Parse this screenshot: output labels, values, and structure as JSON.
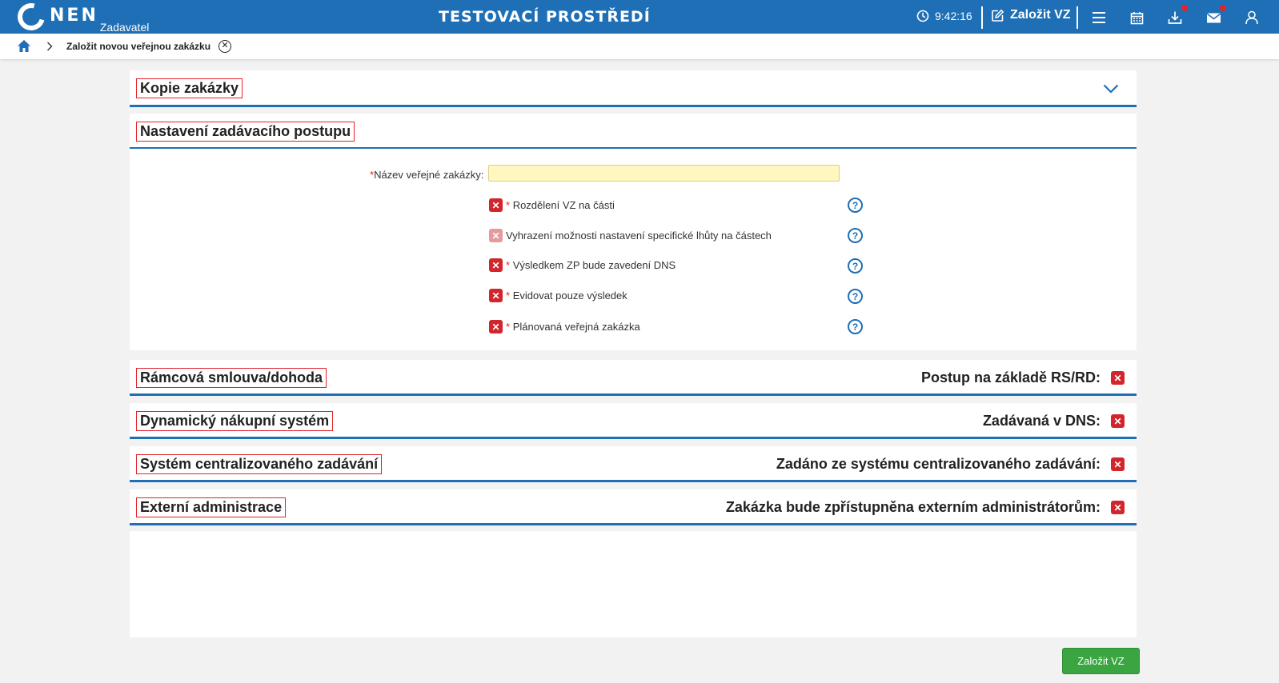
{
  "header": {
    "logo_text": "NEN",
    "logo_sub": "Zadavatel",
    "environment_title": "TESTOVACÍ PROSTŘEDÍ",
    "time": "9:42:16",
    "create_label": "Založit VZ",
    "icons": [
      "clock-icon",
      "edit-icon",
      "menu-icon",
      "calendar-icon",
      "download-icon",
      "mail-icon",
      "user-icon"
    ],
    "accent_color": "#1e6fb5",
    "notification_color": "#e3222a"
  },
  "breadcrumb": {
    "current": "Založit novou veřejnou zakázku",
    "close_glyph": "✕"
  },
  "sections": {
    "copy": {
      "title": "Kopie zakázky"
    },
    "settings": {
      "title": "Nastavení zadávacího postupu"
    },
    "framework": {
      "title": "Rámcová smlouva/dohoda",
      "right_label": "Postup na základě RS/RD:"
    },
    "dns": {
      "title": "Dynamický nákupní systém",
      "right_label": "Zadávaná v DNS:"
    },
    "central": {
      "title": "Systém centralizovaného zadávání",
      "right_label": "Zadáno ze systému centralizovaného zadávání:"
    },
    "external": {
      "title": "Externí administrace",
      "right_label": "Zakázka bude zpřístupněna externím administrátorům:"
    }
  },
  "form": {
    "name_label": "Název veřejné zakázky:",
    "name_value": "",
    "required_mark": "*",
    "checks": [
      {
        "label": "Rozdělení VZ na části",
        "required": true,
        "value": false
      },
      {
        "label": "Vyhrazení možnosti nastavení specifické lhůty na částech",
        "required": false,
        "value": false,
        "disabled": true
      },
      {
        "label": "Výsledkem ZP bude zavedení DNS",
        "required": true,
        "value": false
      },
      {
        "label": "Evidovat pouze výsledek",
        "required": true,
        "value": false
      },
      {
        "label": "Plánovaná veřejná zakázka",
        "required": true,
        "value": false
      }
    ],
    "help_glyph": "?",
    "false_glyph": "✕"
  },
  "actions": {
    "submit_label": "Založit VZ",
    "submit_color": "#3aa541"
  }
}
